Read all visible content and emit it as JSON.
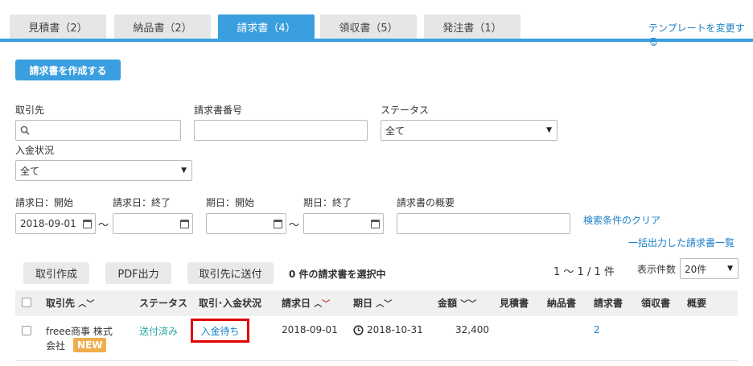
{
  "tabs": [
    {
      "label": "見積書（2）"
    },
    {
      "label": "納品書（2）"
    },
    {
      "label": "請求書（4）"
    },
    {
      "label": "領収書（5）"
    },
    {
      "label": "発注書（1）"
    }
  ],
  "template_link": "テンプレートを変更する",
  "create_button": "請求書を作成する",
  "filters": {
    "partner_label": "取引先",
    "partner_value": "",
    "invoice_number_label": "請求書番号",
    "invoice_number_value": "",
    "status_label": "ステータス",
    "status_value": "全て",
    "payment_label": "入金状況",
    "payment_value": "全て",
    "date_start_label": "請求日：開始",
    "date_start_value": "2018-09-01",
    "date_end_label": "請求日：終了",
    "date_end_value": "",
    "due_start_label": "期日：開始",
    "due_start_value": "",
    "due_end_label": "期日：終了",
    "due_end_value": "",
    "summary_label": "請求書の概要",
    "summary_value": "",
    "clear_link": "検索条件のクリア",
    "bulk_link": "一括出力した請求書一覧",
    "tilde": "〜"
  },
  "actions": {
    "create_transaction": "取引作成",
    "pdf_output": "PDF出力",
    "send_to_partner": "取引先に送付",
    "selected_count": "0 件の請求書を選択中",
    "pagination": "1 〜 1 / 1 件",
    "per_page_label": "表示件数",
    "per_page_value": "20件"
  },
  "table": {
    "headers": {
      "partner": "取引先",
      "status": "ステータス",
      "transaction": "取引･入金状況",
      "invoice_date": "請求日",
      "due_date": "期日",
      "amount": "金額",
      "quote": "見積書",
      "delivery": "納品書",
      "invoice": "請求書",
      "receipt": "領収書",
      "summary": "概要"
    },
    "rows": [
      {
        "partner_line1": "freee商事 株式",
        "partner_line2": "会社",
        "new_badge": "NEW",
        "status": "送付済み",
        "transaction": "入金待ち",
        "invoice_date": "2018-09-01",
        "due_date": "2018-10-31",
        "amount": "32,400",
        "invoice": "2"
      }
    ]
  },
  "colors": {
    "accent": "#3a9fde",
    "link": "#1a7fc7",
    "status_green": "#2aa7a0",
    "new_badge": "#f0ad4e",
    "highlight_red": "#e00000"
  }
}
